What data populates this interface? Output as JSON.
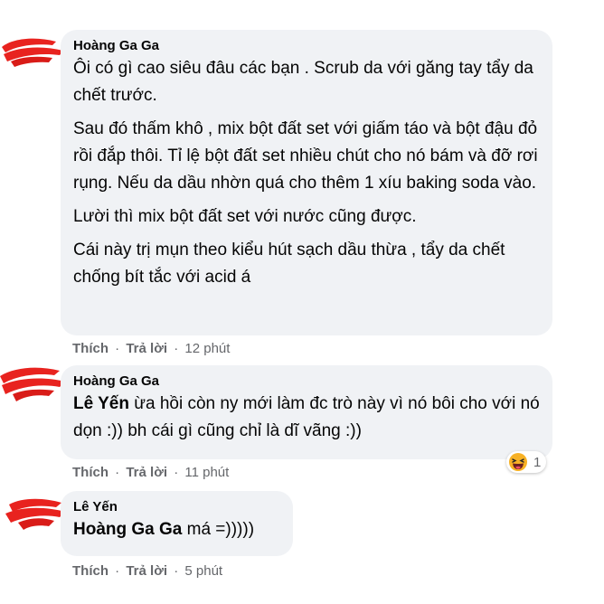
{
  "comments": [
    {
      "author": "Hoàng Ga Ga",
      "paragraphs": [
        "Ôi có gì cao siêu đâu các bạn . Scrub da với găng tay tẩy da chết trước.",
        "Sau đó thấm khô , mix bột đất set với giấm táo và bột đậu đỏ rồi đắp thôi. Tỉ lệ bột đất set nhiều chút cho nó bám và đỡ rơi rụng. Nếu da dầu nhờn quá cho thêm 1 xíu baking soda vào.",
        "Lười thì mix bột đất set với nước cũng được.",
        "Cái này trị mụn theo kiểu hút sạch dầu thừa , tẩy da chết chống bít tắc với acid á"
      ],
      "like_label": "Thích",
      "reply_label": "Trả lời",
      "separator": "·",
      "time": "12 phút"
    },
    {
      "author": "Hoàng Ga Ga",
      "mention": "Lê Yến",
      "text": " ừa hồi còn ny mới làm đc trò này vì nó bôi cho với nó dọn :)) bh cái gì cũng chỉ là dĩ vãng :))",
      "like_label": "Thích",
      "reply_label": "Trả lời",
      "separator": "·",
      "time": "11 phút",
      "reaction": {
        "icon": "haha-emoji-icon",
        "count": "1"
      }
    },
    {
      "author": "Lê Yến",
      "mention": "Hoàng Ga Ga",
      "text": " má =)))))",
      "like_label": "Thích",
      "reply_label": "Trả lời",
      "separator": "·",
      "time": "5 phút"
    }
  ]
}
